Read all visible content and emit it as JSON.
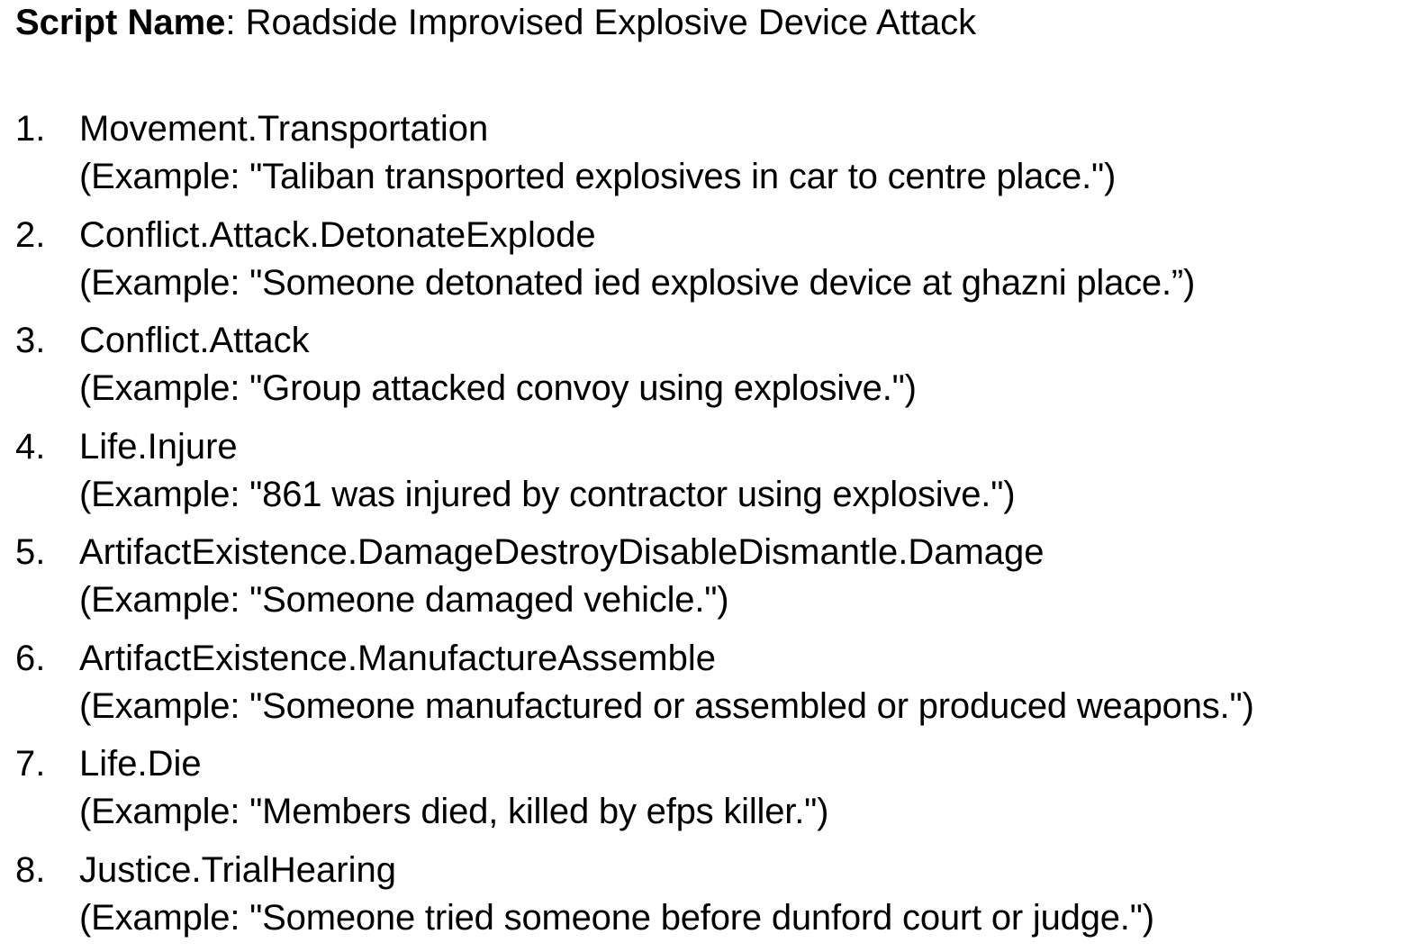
{
  "header": {
    "label": "Script Name",
    "separator": ": ",
    "value": "Roadside Improvised Explosive Device Attack"
  },
  "items": [
    {
      "number": "1.",
      "event_type": "Movement.Transportation",
      "example": "(Example: \"Taliban transported explosives in car to centre place.\")"
    },
    {
      "number": "2.",
      "event_type": "Conflict.Attack.DetonateExplode",
      "example": "(Example: \"Someone detonated ied explosive device at ghazni place.”)"
    },
    {
      "number": "3.",
      "event_type": "Conflict.Attack",
      "example": "(Example: \"Group attacked convoy using explosive.\")"
    },
    {
      "number": "4.",
      "event_type": "Life.Injure",
      "example": "(Example: \"861 was injured by contractor using explosive.\")"
    },
    {
      "number": "5.",
      "event_type": "ArtifactExistence.DamageDestroyDisableDismantle.Damage",
      "example": "(Example: \"Someone damaged vehicle.\")"
    },
    {
      "number": "6.",
      "event_type": "ArtifactExistence.ManufactureAssemble",
      "example": "(Example: \"Someone manufactured or assembled or produced weapons.\")"
    },
    {
      "number": "7.",
      "event_type": "Life.Die",
      "example": "(Example: \"Members died, killed by efps killer.\")"
    },
    {
      "number": "8.",
      "event_type": "Justice.TrialHearing",
      "example": "(Example: \"Someone tried someone before dunford court or judge.\")"
    }
  ]
}
